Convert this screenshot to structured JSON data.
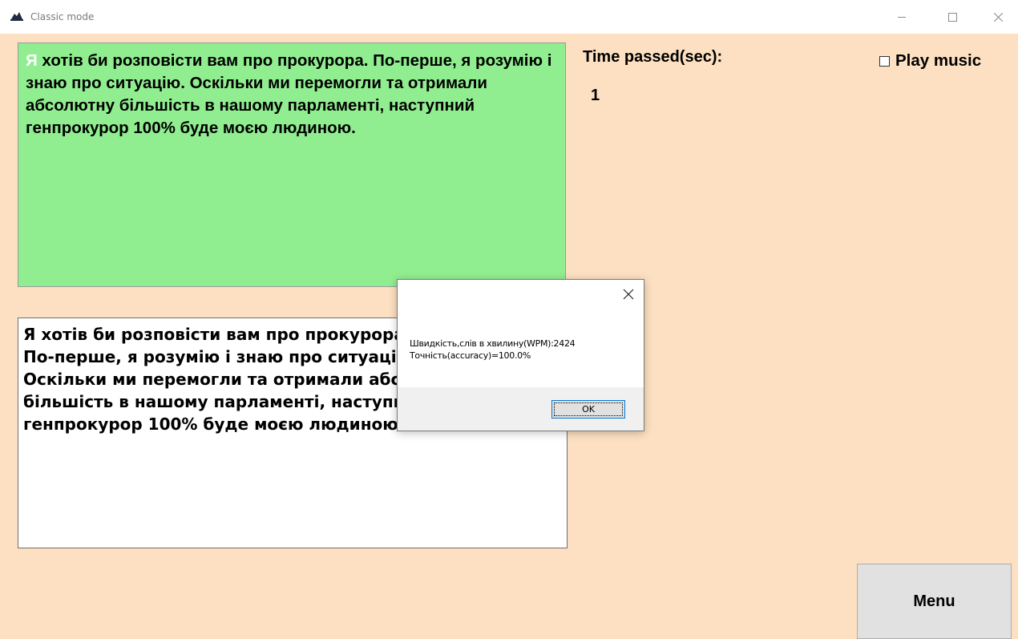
{
  "window": {
    "title": "Classic mode",
    "icon": "app-icon"
  },
  "target_text": {
    "completed": "Я",
    "remaining": " хотів би розповісти вам про прокурора. По-перше, я розумію і знаю про ситуацію. Оскільки ми перемогли та отримали абсолютну більшість в нашому парламенті, наступний генпрокурор 100% буде моєю людиною."
  },
  "typed_text": "Я хотів би розповісти вам про прокурора.\nПо-перше, я розумію і знаю про ситуацію.\nОскільки ми перемогли та отримали абсолютну\nбільшість в нашому парламенті, наступний\nгенпрокурор 100% буде моєю людиною.",
  "timer": {
    "label": "Time passed(sec):",
    "value": "1"
  },
  "music": {
    "label": "Play music",
    "checked": false
  },
  "menu_button": "Menu",
  "dialog": {
    "line1": "Швидкість,слів в хвилину(WPM):2424",
    "line2": "Точність(accuracy)=100.0%",
    "ok_label": "OK"
  },
  "colors": {
    "background": "#fde0c1",
    "target_background": "#90ee90",
    "completed_text": "#ffffff",
    "button_background": "#e1e1e1",
    "focus_border": "#0078d7"
  }
}
